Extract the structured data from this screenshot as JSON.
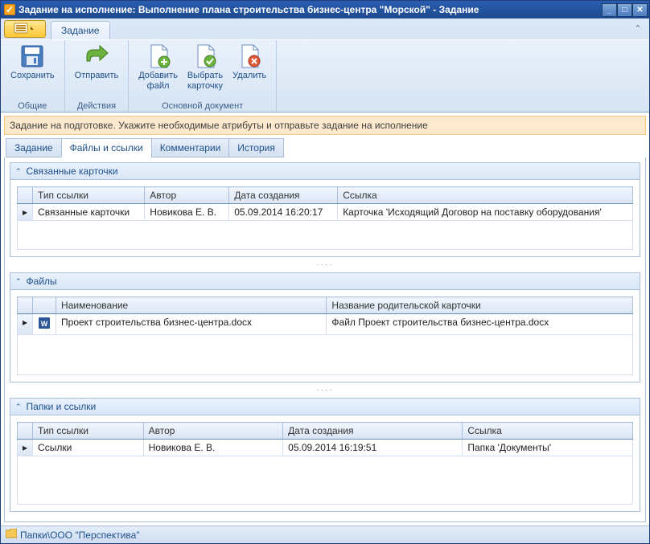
{
  "window": {
    "title": "Задание на исполнение: Выполнение плана строительства бизнес-центра \"Морской\" - Задание"
  },
  "ribbon": {
    "tab": "Задание",
    "groups": {
      "common": {
        "title": "Общие",
        "save": "Сохранить"
      },
      "actions": {
        "title": "Действия",
        "send": "Отправить"
      },
      "docs": {
        "title": "Основной документ",
        "add": "Добавить\nфайл",
        "select": "Выбрать\nкарточку",
        "delete": "Удалить"
      }
    }
  },
  "infobar": "Задание на подготовке. Укажите необходимые атрибуты и отправьте задание на исполнение",
  "subtabs": {
    "task": "Задание",
    "files": "Файлы и ссылки",
    "comments": "Комментарии",
    "history": "История"
  },
  "panels": {
    "related": {
      "title": "Связанные карточки",
      "columns": {
        "type": "Тип ссылки",
        "author": "Автор",
        "date": "Дата создания",
        "link": "Ссылка"
      },
      "rows": [
        {
          "type": "Связанные карточки",
          "author": "Новикова Е. В.",
          "date": "05.09.2014 16:20:17",
          "link": "Карточка 'Исходящий Договор на поставку оборудования'"
        }
      ]
    },
    "files": {
      "title": "Файлы",
      "columns": {
        "name": "Наименование",
        "parent": "Название родительской карточки"
      },
      "rows": [
        {
          "name": "Проект строительства бизнес-центра.docx",
          "parent": "Файл Проект строительства бизнес-центра.docx"
        }
      ]
    },
    "folders": {
      "title": "Папки и ссылки",
      "columns": {
        "type": "Тип ссылки",
        "author": "Автор",
        "date": "Дата создания",
        "link": "Ссылка"
      },
      "rows": [
        {
          "type": "Ссылки",
          "author": "Новикова Е. В.",
          "date": "05.09.2014 16:19:51",
          "link": "Папка 'Документы'"
        }
      ]
    }
  },
  "statusbar": "Папки\\ООО \"Перспектива\""
}
